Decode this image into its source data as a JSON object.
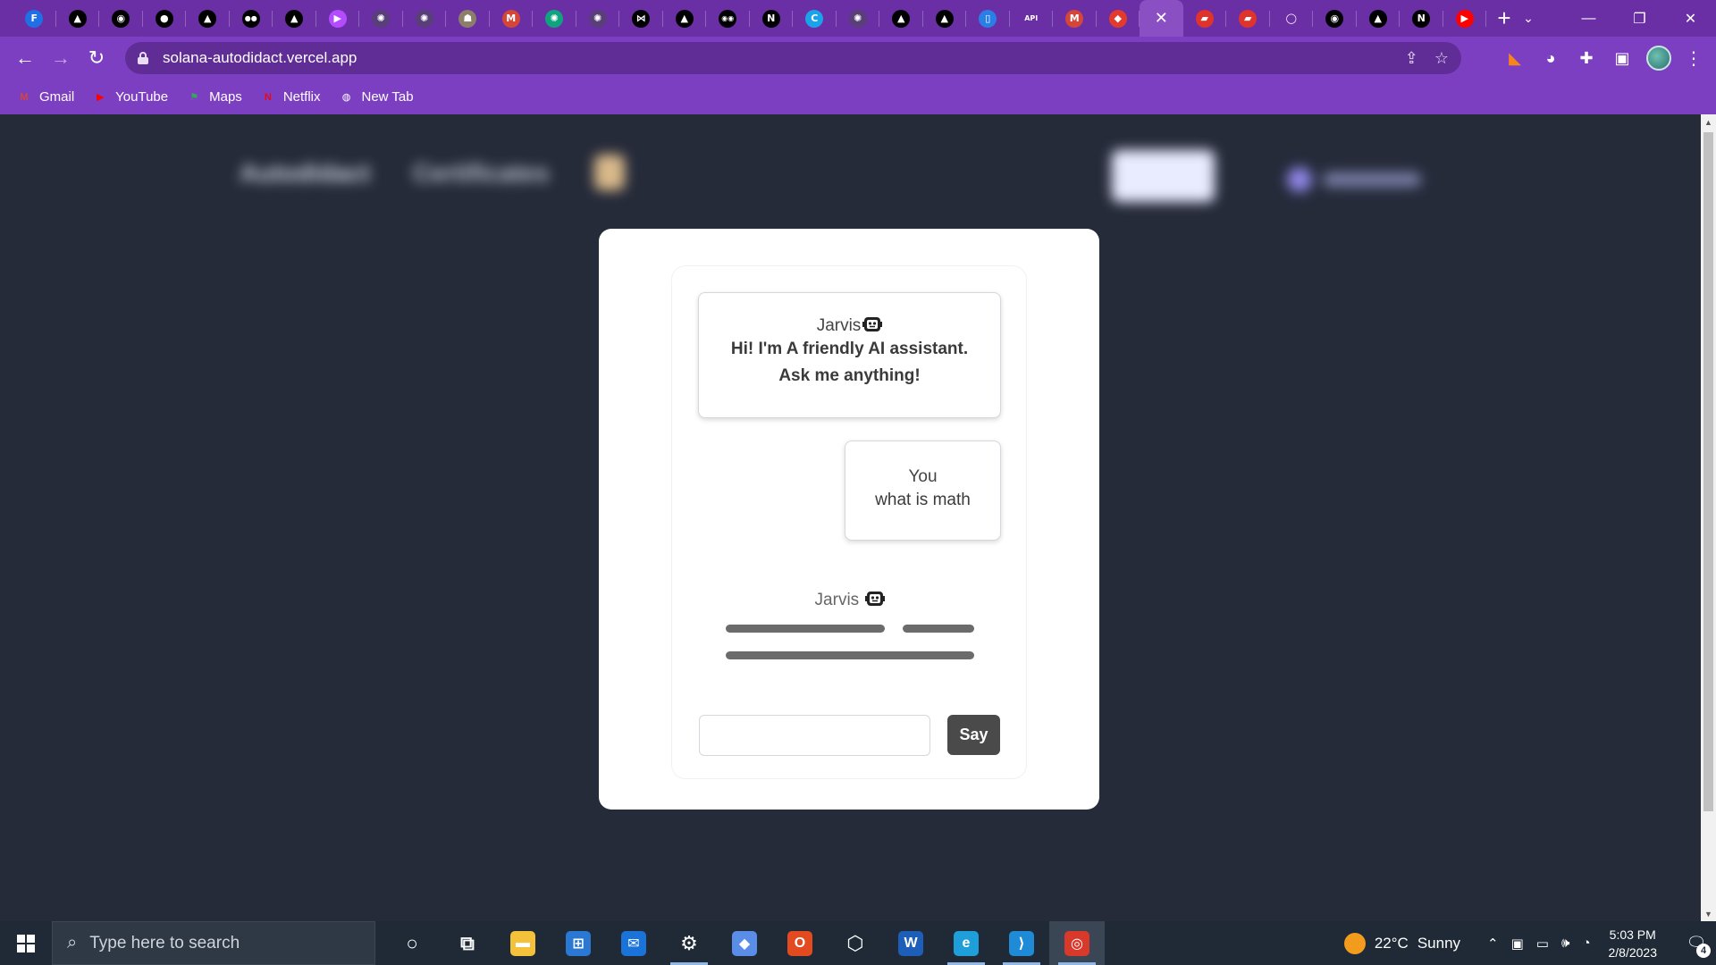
{
  "browser": {
    "tabs": [
      {
        "icon": "frappe-icon",
        "glyph": "F",
        "bg": "#1f6fe5"
      },
      {
        "icon": "vercel-icon",
        "glyph": "▲",
        "bg": "#000000"
      },
      {
        "icon": "circle-logo-icon",
        "glyph": "◉",
        "bg": "#000000"
      },
      {
        "icon": "github-icon",
        "glyph": "●",
        "bg": "#000000"
      },
      {
        "icon": "vercel-icon",
        "glyph": "▲",
        "bg": "#000000"
      },
      {
        "icon": "medium-icon",
        "glyph": "●●",
        "bg": "#000000"
      },
      {
        "icon": "vercel-icon",
        "glyph": "▲",
        "bg": "#000000"
      },
      {
        "icon": "play-arrow-icon",
        "glyph": "▶",
        "bg": "#b44bff"
      },
      {
        "icon": "openai-icon",
        "glyph": "✺",
        "bg": "#5a3e7a"
      },
      {
        "icon": "openai-icon",
        "glyph": "✺",
        "bg": "#5a3e7a"
      },
      {
        "icon": "robot-icon",
        "glyph": "☗",
        "bg": "#8d7e6a"
      },
      {
        "icon": "gmail-icon",
        "glyph": "M",
        "bg": "#d44638"
      },
      {
        "icon": "chatgpt-icon",
        "glyph": "✺",
        "bg": "#10a37f"
      },
      {
        "icon": "openai-icon",
        "glyph": "✺",
        "bg": "#5a3e7a"
      },
      {
        "icon": "bow-icon",
        "glyph": "⋈",
        "bg": "#000000"
      },
      {
        "icon": "vercel-icon",
        "glyph": "▲",
        "bg": "#000000"
      },
      {
        "icon": "eyes-icon",
        "glyph": "◉◉",
        "bg": "#000000"
      },
      {
        "icon": "notion-icon",
        "glyph": "N",
        "bg": "#000000"
      },
      {
        "icon": "c-logo-icon",
        "glyph": "C",
        "bg": "#1aa3e8"
      },
      {
        "icon": "openai-icon",
        "glyph": "✺",
        "bg": "#5a3e7a"
      },
      {
        "icon": "vercel-icon",
        "glyph": "▲",
        "bg": "#000000"
      },
      {
        "icon": "vercel-icon",
        "glyph": "▲",
        "bg": "#000000"
      },
      {
        "icon": "bottle-icon",
        "glyph": "▯",
        "bg": "#2a7fe6"
      },
      {
        "icon": "api-icon",
        "glyph": "API",
        "bg": "#6b2fa5"
      },
      {
        "icon": "gmail-icon",
        "glyph": "M",
        "bg": "#d44638"
      },
      {
        "icon": "diamond-icon",
        "glyph": "◆",
        "bg": "#e23b2e"
      },
      {
        "icon": "close-icon",
        "glyph": "✕",
        "bg": "transparent",
        "active": true
      },
      {
        "icon": "book-icon",
        "glyph": "▰",
        "bg": "#e0332b"
      },
      {
        "icon": "book-icon",
        "glyph": "▰",
        "bg": "#e0332b"
      },
      {
        "icon": "ring-icon",
        "glyph": "◯",
        "bg": "#6b2fa5"
      },
      {
        "icon": "circle-logo-icon",
        "glyph": "◉",
        "bg": "#000000"
      },
      {
        "icon": "vercel-icon",
        "glyph": "▲",
        "bg": "#000000"
      },
      {
        "icon": "notion-icon",
        "glyph": "N",
        "bg": "#000000"
      },
      {
        "icon": "youtube-icon",
        "glyph": "▶",
        "bg": "#ff0000"
      }
    ],
    "url": "solana-autodidact.vercel.app",
    "bookmarks": [
      {
        "label": "Gmail",
        "icon": "gmail-icon",
        "glyph": "M",
        "color": "#d44638"
      },
      {
        "label": "YouTube",
        "icon": "youtube-icon",
        "glyph": "▶",
        "color": "#ff0000"
      },
      {
        "label": "Maps",
        "icon": "maps-icon",
        "glyph": "⚑",
        "color": "#34a853"
      },
      {
        "label": "Netflix",
        "icon": "netflix-icon",
        "glyph": "N",
        "color": "#e50914"
      },
      {
        "label": "New Tab",
        "icon": "globe-icon",
        "glyph": "◍",
        "color": "#ffffff"
      }
    ]
  },
  "chat": {
    "greeting_sender": "Jarvis",
    "greeting_text": "Hi! I'm A friendly AI assistant. Ask me anything!",
    "user_sender": "You",
    "user_text": "what is math",
    "typing_sender": "Jarvis",
    "say_button": "Say",
    "input_value": ""
  },
  "taskbar": {
    "search_placeholder": "Type here to search",
    "apps": [
      {
        "icon": "cortana-icon",
        "glyph": "○",
        "bg": "transparent"
      },
      {
        "icon": "task-view-icon",
        "glyph": "⧉",
        "bg": "transparent"
      },
      {
        "icon": "file-explorer-icon",
        "glyph": "▬",
        "bg": "#f3c13a"
      },
      {
        "icon": "microsoft-store-icon",
        "glyph": "⊞",
        "bg": "#2b78d4"
      },
      {
        "icon": "mail-icon",
        "glyph": "✉",
        "bg": "#1a73d9"
      },
      {
        "icon": "settings-icon",
        "glyph": "⚙",
        "bg": "transparent"
      },
      {
        "icon": "git-icon",
        "glyph": "◆",
        "bg": "#5a8de8"
      },
      {
        "icon": "office-icon",
        "glyph": "O",
        "bg": "#e34a1f"
      },
      {
        "icon": "unity-icon",
        "glyph": "⬡",
        "bg": "transparent"
      },
      {
        "icon": "word-icon",
        "glyph": "W",
        "bg": "#1d5fb8"
      },
      {
        "icon": "edge-icon",
        "glyph": "e",
        "bg": "#1f9fd9"
      },
      {
        "icon": "vscode-icon",
        "glyph": "⟩",
        "bg": "#1f8ad6"
      },
      {
        "icon": "chrome-icon",
        "glyph": "◎",
        "bg": "#d9392a",
        "active": true
      }
    ],
    "weather_temp": "22°C",
    "weather_text": "Sunny",
    "time": "5:03 PM",
    "date": "2/8/2023",
    "notification_count": "4"
  }
}
